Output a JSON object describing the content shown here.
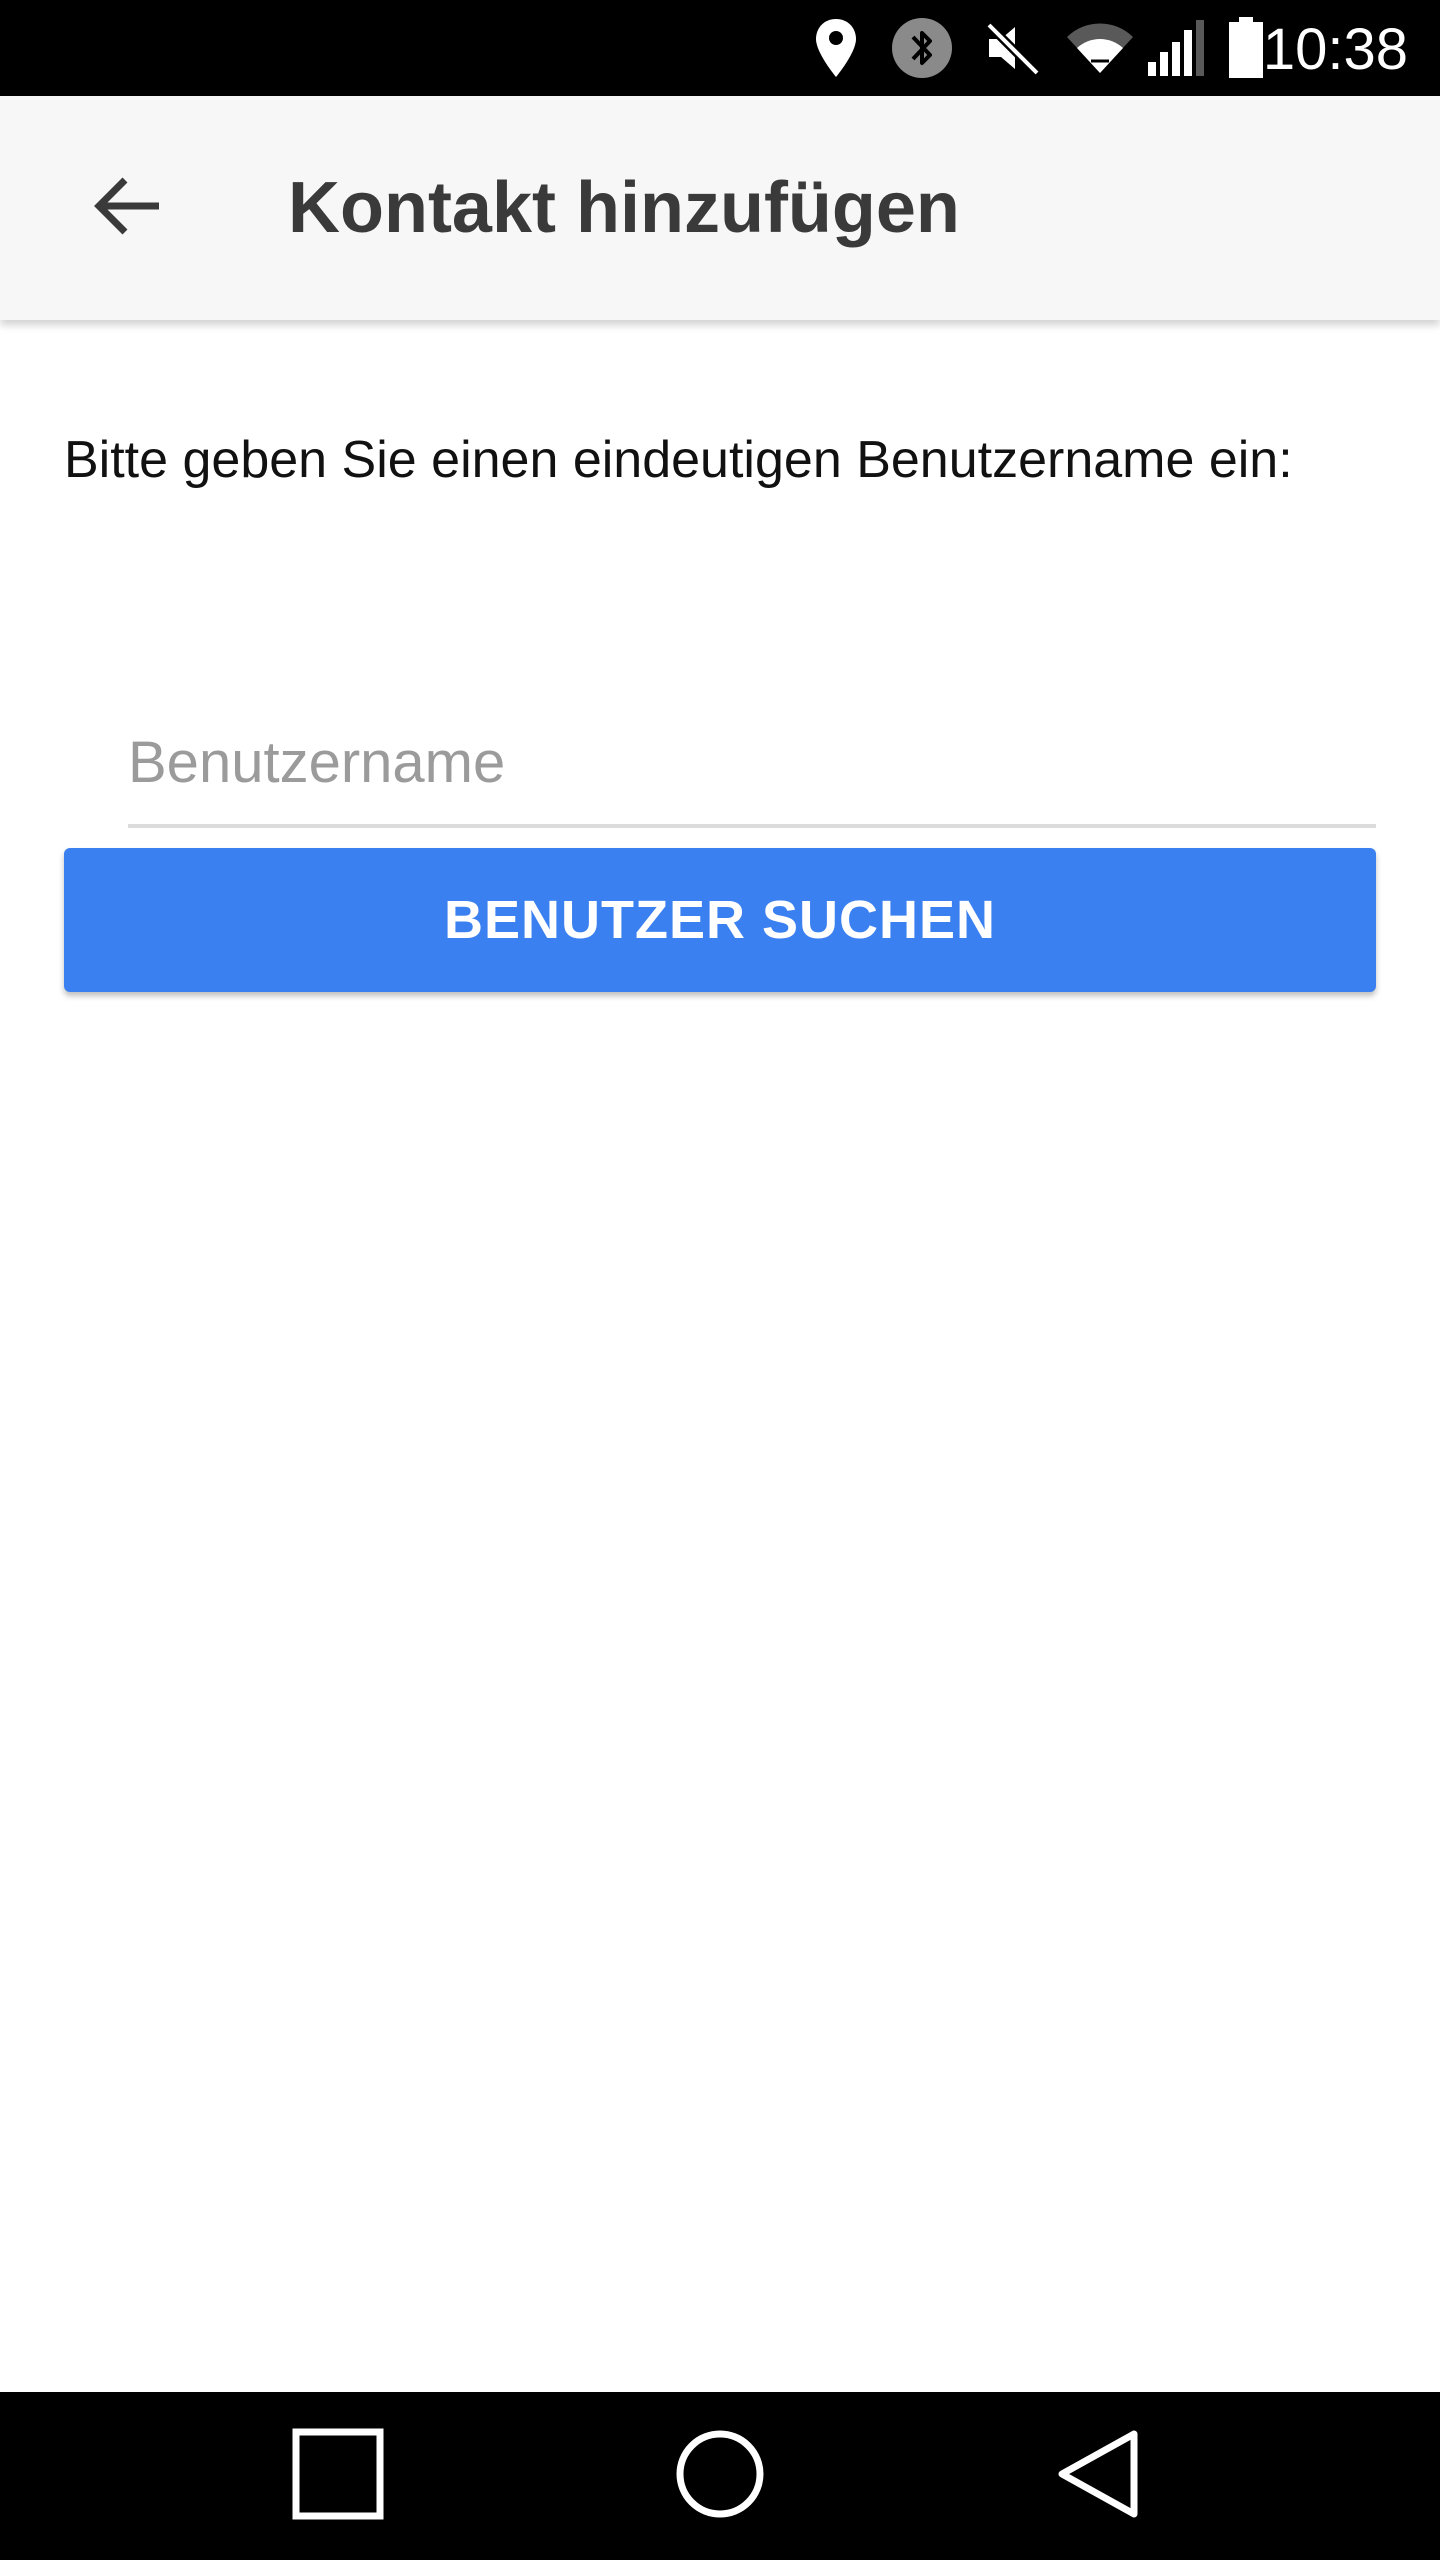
{
  "status_bar": {
    "time": "10:38",
    "icons": [
      "location-icon",
      "bluetooth-icon",
      "muted-icon",
      "wifi-icon",
      "signal-icon",
      "battery-icon"
    ]
  },
  "app_bar": {
    "title": "Kontakt hinzufügen",
    "back_icon": "arrow-back-icon"
  },
  "content": {
    "prompt": "Bitte geben Sie einen eindeutigen Benutzername ein:",
    "username_field": {
      "value": "",
      "placeholder": "Benutzername"
    },
    "search_button_label": "BENUTZER SUCHEN"
  },
  "nav_bar": {
    "icons": [
      "recents-icon",
      "home-icon",
      "back-icon"
    ]
  },
  "colors": {
    "accent": "#3b80f0",
    "appbar_bg": "#f7f7f7",
    "title_text": "#3a3a3a",
    "placeholder_text": "#9b9b9b"
  }
}
